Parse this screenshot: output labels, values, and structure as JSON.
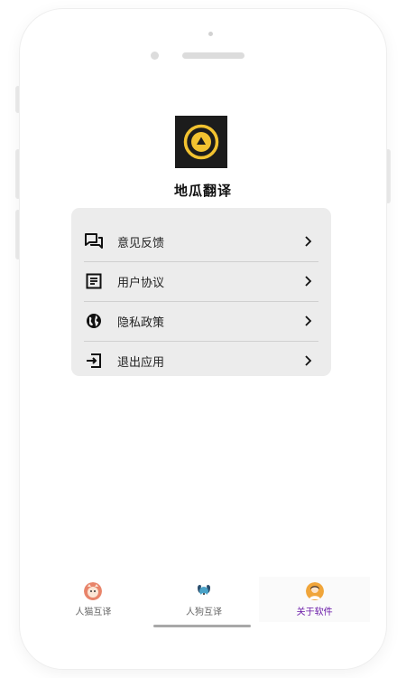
{
  "app": {
    "title": "地瓜翻译",
    "accent_color": "#f2c230",
    "logo_icon": "play-circle-logo-icon"
  },
  "menu": {
    "items": [
      {
        "id": "feedback",
        "label": "意见反馈",
        "icon": "chat-bubbles-icon"
      },
      {
        "id": "agreement",
        "label": "用户协议",
        "icon": "document-icon"
      },
      {
        "id": "privacy",
        "label": "隐私政策",
        "icon": "globe-icon"
      },
      {
        "id": "exit",
        "label": "退出应用",
        "icon": "exit-icon"
      }
    ],
    "chevron_icon": "chevron-right-icon"
  },
  "tabbar": {
    "active_color": "#6a1aa8",
    "tabs": [
      {
        "label": "人猫互译",
        "icon": "cat-avatar-icon",
        "active": false
      },
      {
        "label": "人狗互译",
        "icon": "dog-avatar-icon",
        "active": false
      },
      {
        "label": "关于软件",
        "icon": "user-avatar-icon",
        "active": true
      }
    ]
  }
}
